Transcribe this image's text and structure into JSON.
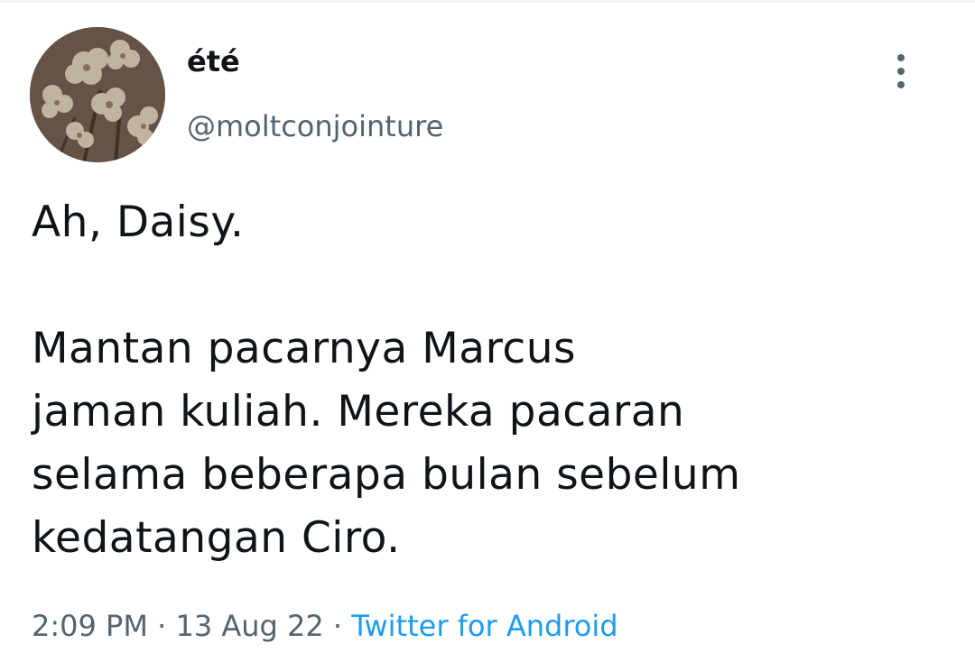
{
  "author": {
    "display_name": "été",
    "handle": "@moltconjointure"
  },
  "tweet": {
    "lines": [
      "Ah, Daisy.",
      "",
      "Mantan pacarnya Marcus",
      "jaman kuliah. Mereka pacaran",
      "selama beberapa bulan sebelum",
      "kedatangan Ciro."
    ]
  },
  "meta": {
    "time": "2:09 PM",
    "separator": "·",
    "date": "13 Aug 22",
    "source": "Twitter for Android"
  },
  "colors": {
    "text": "#0f1419",
    "secondary": "#536471",
    "link": "#1d9bf0"
  },
  "icons": {
    "more": "vertical-ellipsis-icon",
    "avatar": "flower-avatar-image"
  }
}
